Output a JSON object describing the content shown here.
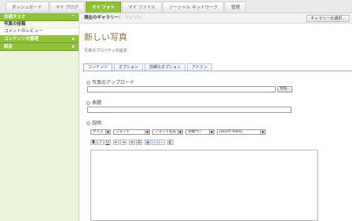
{
  "top_tabs": [
    {
      "label": "ダッシュボード",
      "active": false
    },
    {
      "label": "マイ ブログ",
      "active": false
    },
    {
      "label": "マイ フォト",
      "active": true
    },
    {
      "label": "マイ ファイル",
      "active": false
    },
    {
      "label": "ソーシャル ネットワーク",
      "active": false
    },
    {
      "label": "管理",
      "active": false
    }
  ],
  "sidebar": {
    "sections": [
      {
        "label": "共通タスク",
        "chevron": "^",
        "items": [
          {
            "label": "写真の投稿",
            "active": true
          },
          {
            "label": "コメントのレビュー",
            "active": false
          }
        ]
      },
      {
        "label": "コンテンツの管理",
        "chevron": "v",
        "items": []
      },
      {
        "label": "設定",
        "chevron": "v",
        "items": []
      }
    ]
  },
  "gallery": {
    "label": "現在のギャラリー：",
    "value": "リンリン",
    "select_button": "ギャラリーの選択..."
  },
  "page": {
    "title": "新しい写真",
    "subtitle": "写真のプロパティの設定"
  },
  "form_tabs": [
    "コンテンツ",
    "オプション",
    "詳細なオプション",
    "アドミン"
  ],
  "form": {
    "upload_label": "写真のアップロード",
    "browse_button": "参照...",
    "title_label": "表題",
    "description_label": "説明",
    "editor_selects": [
      {
        "value": "サイズ",
        "width": 24
      },
      {
        "value": "フォント",
        "width": 45
      },
      {
        "value": "フォント名前",
        "width": 38
      },
      {
        "value": "等幅ペン",
        "width": 36
      },
      {
        "value": "Desert Valley",
        "width": 60
      }
    ]
  },
  "colors": {
    "accent_green": "#8fc23a",
    "title_brown": "#8a6d3b",
    "tab_blue": "#9bb0d6"
  }
}
